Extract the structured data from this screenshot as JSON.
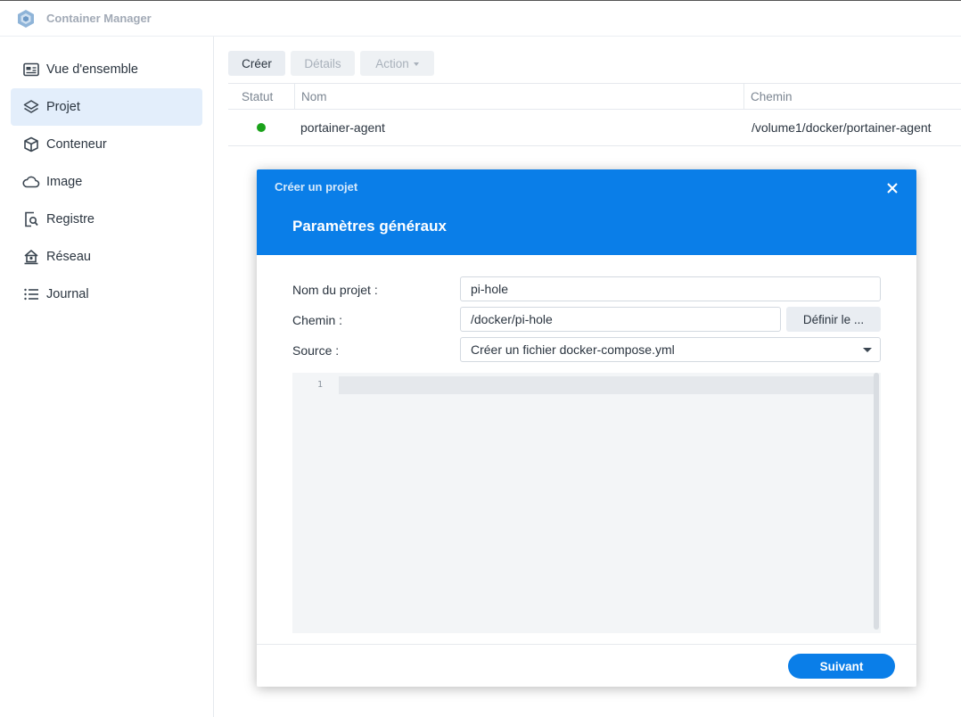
{
  "app": {
    "title": "Container Manager",
    "icon": "container-manager-icon"
  },
  "sidebar": {
    "items": [
      {
        "label": "Vue d'ensemble",
        "icon": "overview-icon"
      },
      {
        "label": "Projet",
        "icon": "layers-icon",
        "active": true
      },
      {
        "label": "Conteneur",
        "icon": "cube-icon"
      },
      {
        "label": "Image",
        "icon": "cloud-icon"
      },
      {
        "label": "Registre",
        "icon": "registry-search-icon"
      },
      {
        "label": "Réseau",
        "icon": "network-house-icon"
      },
      {
        "label": "Journal",
        "icon": "list-icon"
      }
    ]
  },
  "toolbar": {
    "create": "Créer",
    "details": "Détails",
    "action": "Action"
  },
  "table": {
    "columns": [
      "Statut",
      "Nom",
      "Chemin"
    ],
    "rows": [
      {
        "status": "running",
        "status_color": "#1aa21a",
        "name": "portainer-agent",
        "path": "/volume1/docker/portainer-agent"
      }
    ]
  },
  "dialog": {
    "title": "Créer un projet",
    "subtitle": "Paramètres généraux",
    "fields": {
      "name_label": "Nom du projet :",
      "name_value": "pi-hole",
      "path_label": "Chemin :",
      "path_value": "/docker/pi-hole",
      "path_button": "Définir le ...",
      "source_label": "Source :",
      "source_value": "Créer un fichier docker-compose.yml"
    },
    "editor": {
      "line_number": "1",
      "content": ""
    },
    "next_button": "Suivant"
  },
  "colors": {
    "accent": "#0a7ee8",
    "active_nav_bg": "#e3eefb",
    "status_running": "#1aa21a"
  }
}
